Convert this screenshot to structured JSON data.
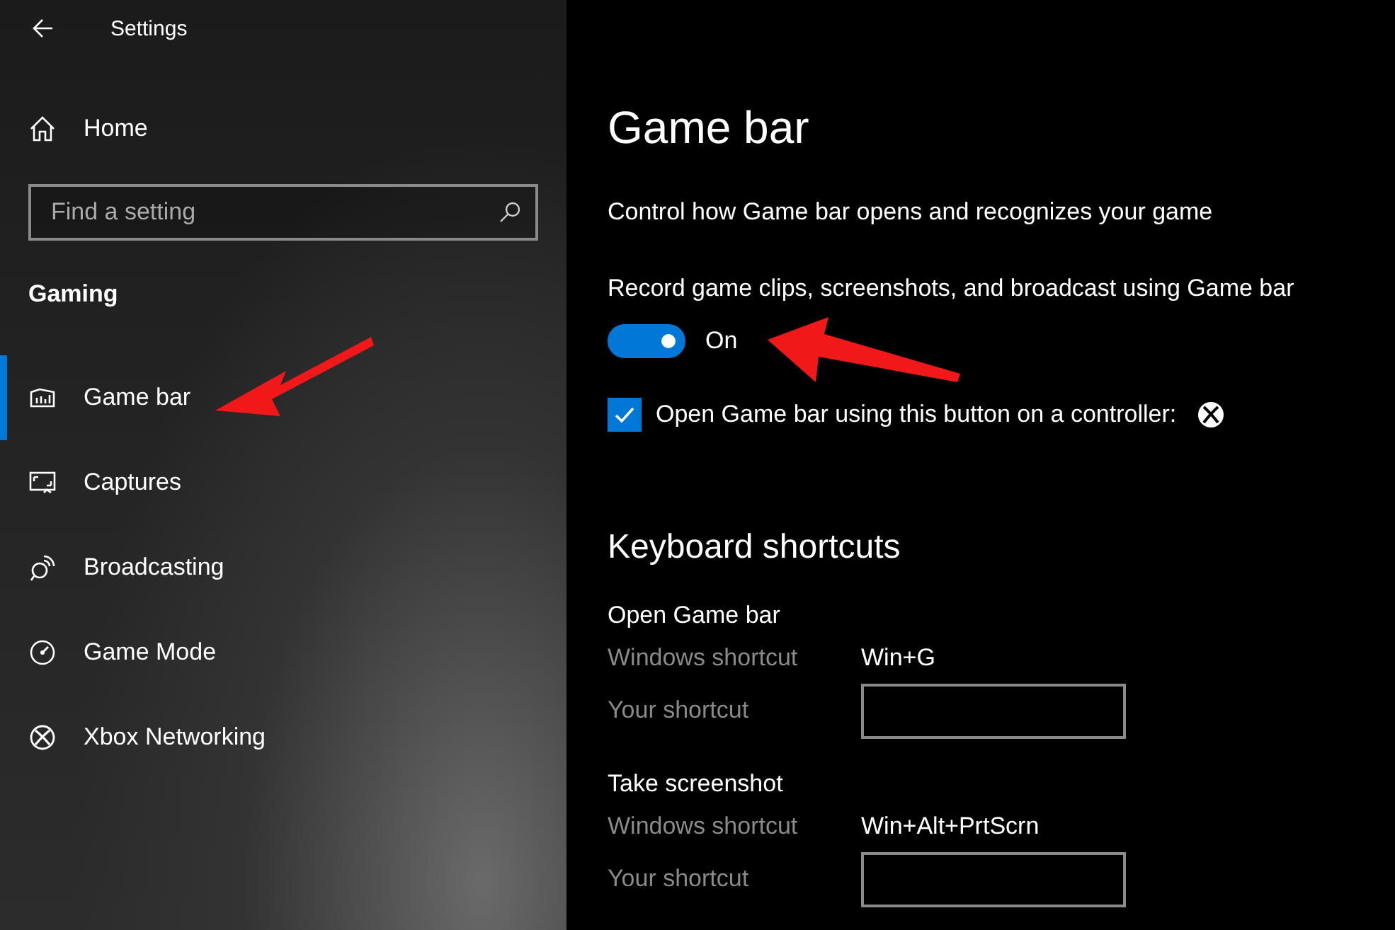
{
  "window": {
    "title": "Settings"
  },
  "sidebar": {
    "home": {
      "label": "Home"
    },
    "search": {
      "placeholder": "Find a setting"
    },
    "section": "Gaming",
    "items": [
      {
        "label": "Game bar",
        "kind": "gamebar",
        "selected": true
      },
      {
        "label": "Captures",
        "kind": "captures",
        "selected": false
      },
      {
        "label": "Broadcasting",
        "kind": "broadcast",
        "selected": false
      },
      {
        "label": "Game Mode",
        "kind": "gamemode",
        "selected": false
      },
      {
        "label": "Xbox Networking",
        "kind": "xbox",
        "selected": false
      }
    ]
  },
  "main": {
    "title": "Game bar",
    "description": "Control how Game bar opens and recognizes your game",
    "toggle": {
      "label": "Record game clips, screenshots, and broadcast using Game bar",
      "on": true,
      "state_text": "On"
    },
    "checkbox": {
      "label": "Open Game bar using this button on a controller:",
      "checked": true
    },
    "shortcuts_title": "Keyboard shortcuts",
    "shortcuts": [
      {
        "name": "Open Game bar",
        "rows": [
          {
            "kind": "text",
            "label": "Windows shortcut",
            "value": "Win+G"
          },
          {
            "kind": "field",
            "label": "Your shortcut"
          }
        ]
      },
      {
        "name": "Take screenshot",
        "rows": [
          {
            "kind": "text",
            "label": "Windows shortcut",
            "value": "Win+Alt+PrtScrn"
          },
          {
            "kind": "field",
            "label": "Your shortcut"
          }
        ]
      }
    ]
  }
}
